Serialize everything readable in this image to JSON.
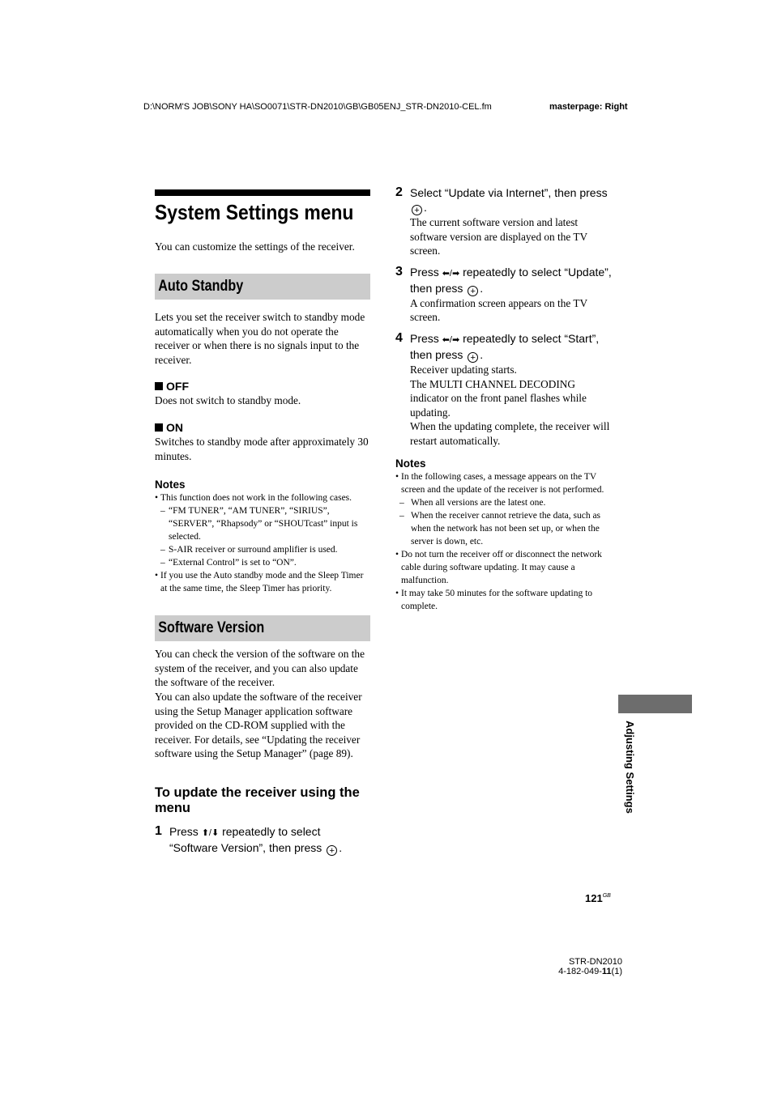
{
  "header": {
    "file_path": "D:\\NORM'S JOB\\SONY HA\\SO0071\\STR-DN2010\\GB\\GB05ENJ_STR-DN2010-CEL.fm",
    "masterpage": "masterpage: Right"
  },
  "page": {
    "title": "System Settings menu",
    "intro": "You can customize the settings of the receiver."
  },
  "auto_standby": {
    "heading": "Auto Standby",
    "description": "Lets you set the receiver switch to standby mode automatically when you do not operate the receiver or when there is no signals input to the receiver.",
    "options": [
      {
        "label": "OFF",
        "description": "Does not switch to standby mode."
      },
      {
        "label": "ON",
        "description": "Switches to standby mode after approximately 30 minutes."
      }
    ],
    "notes_heading": "Notes",
    "notes": [
      "This function does not work in the following cases.",
      "“FM TUNER”, “AM TUNER”, “SIRIUS”, “SERVER”, “Rhapsody” or “SHOUTcast” input is selected.",
      "S-AIR receiver or surround amplifier is used.",
      "“External Control” is set to “ON”.",
      "If you use the Auto standby mode and the Sleep Timer at the same time, the Sleep Timer has priority."
    ]
  },
  "software_version": {
    "heading": "Software Version",
    "description_1": "You can check the version of the software on the system of the receiver, and you can also update the software of the receiver.",
    "description_2": "You can also update the software of the receiver using the Setup Manager application software provided on the CD-ROM supplied with the receiver. For details, see “Updating the receiver software using the Setup Manager” (page 89).",
    "subheading": "To update the receiver using the menu",
    "steps": [
      {
        "num": "1",
        "text_a": "Press ",
        "arrows": "⬆/⬇",
        "text_b": " repeatedly to select “Software Version”, then press ",
        "result": []
      },
      {
        "num": "2",
        "text_a": "Select “Update via Internet”, then press ",
        "arrows": "",
        "text_b": "",
        "result": [
          "The current software version and latest software version are displayed on the TV screen."
        ]
      },
      {
        "num": "3",
        "text_a": "Press ",
        "arrows": "⬅/➡",
        "text_b": " repeatedly to select “Update”, then press ",
        "result": [
          "A confirmation screen appears on the TV screen."
        ]
      },
      {
        "num": "4",
        "text_a": "Press ",
        "arrows": "⬅/➡",
        "text_b": " repeatedly to select “Start”, then press ",
        "result": [
          "Receiver updating starts.",
          "The MULTI CHANNEL DECODING indicator on the front panel flashes while updating.",
          "When the updating complete, the receiver will restart automatically."
        ]
      }
    ],
    "notes_heading": "Notes",
    "notes": [
      "In the following cases, a message appears on the TV screen and the update of the receiver is not performed.",
      "When all versions are the latest one.",
      "When the receiver cannot retrieve the data, such as when the network has not been set up, or when the server is down, etc.",
      "Do not turn the receiver off or disconnect the network cable during software updating. It may cause a malfunction.",
      "It may take 50 minutes for the software updating to complete."
    ]
  },
  "side_tab": {
    "label": "Adjusting Settings"
  },
  "footer": {
    "page_number": "121",
    "page_suffix": "GB",
    "model": "STR-DN2010",
    "part_number_prefix": "4-182-049-",
    "part_number_bold": "11",
    "part_number_suffix": "(1)"
  },
  "icons": {
    "enter": "+",
    "bullet_square": "square"
  }
}
